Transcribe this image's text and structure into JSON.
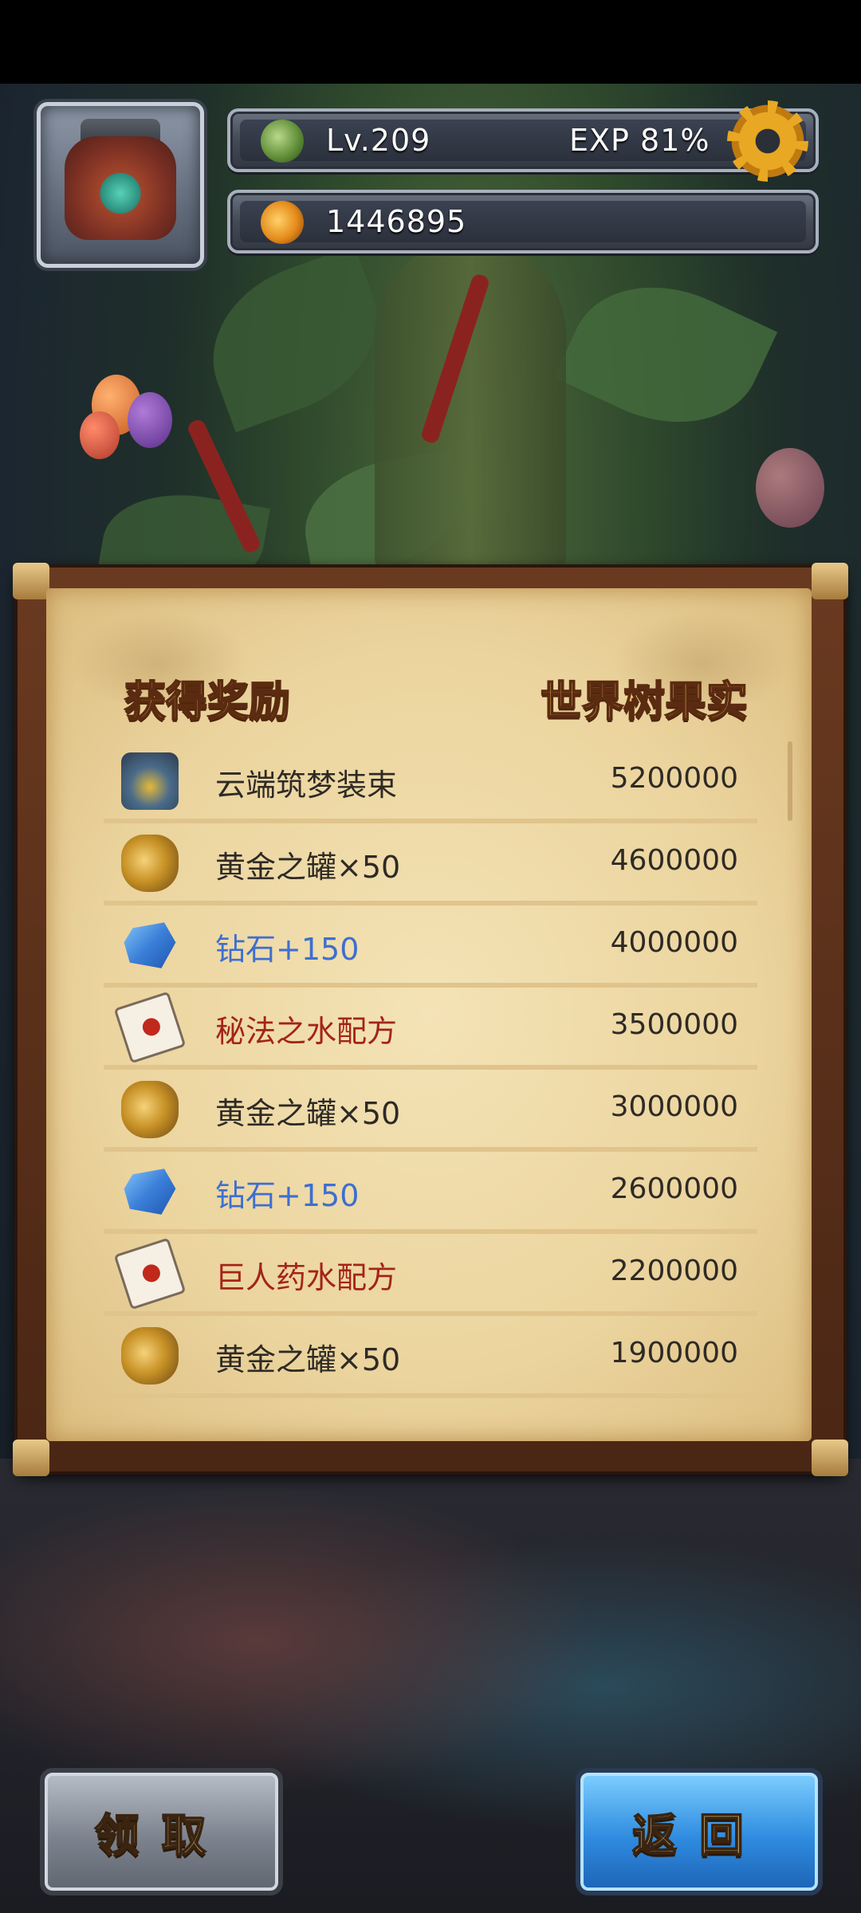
{
  "player": {
    "level": "Lv.209",
    "exp": "EXP  81%",
    "currency": "1446895"
  },
  "panel": {
    "left_header": "获得奖励",
    "right_header": "世界树果实",
    "rewards": [
      {
        "name": "云端筑梦装束",
        "value": "5200000",
        "icon": "outfit-icon",
        "color": "normal"
      },
      {
        "name": "黄金之罐×50",
        "value": "4600000",
        "icon": "golden-jar-icon",
        "color": "normal"
      },
      {
        "name": "钻石+150",
        "value": "4000000",
        "icon": "diamond-icon",
        "color": "blue"
      },
      {
        "name": "秘法之水配方",
        "value": "3500000",
        "icon": "recipe-scroll-icon",
        "color": "red"
      },
      {
        "name": "黄金之罐×50",
        "value": "3000000",
        "icon": "golden-jar-icon",
        "color": "normal"
      },
      {
        "name": "钻石+150",
        "value": "2600000",
        "icon": "diamond-icon",
        "color": "blue"
      },
      {
        "name": "巨人药水配方",
        "value": "2200000",
        "icon": "recipe-scroll-icon",
        "color": "red"
      },
      {
        "name": "黄金之罐×50",
        "value": "1900000",
        "icon": "golden-jar-icon",
        "color": "normal"
      }
    ]
  },
  "buttons": {
    "claim": "领取",
    "back": "返回"
  },
  "colors": {
    "blue_text": "#3e6fd0",
    "red_text": "#a3241a",
    "header_gold": "#f3c76a",
    "back_button": "#2f8ce0"
  }
}
